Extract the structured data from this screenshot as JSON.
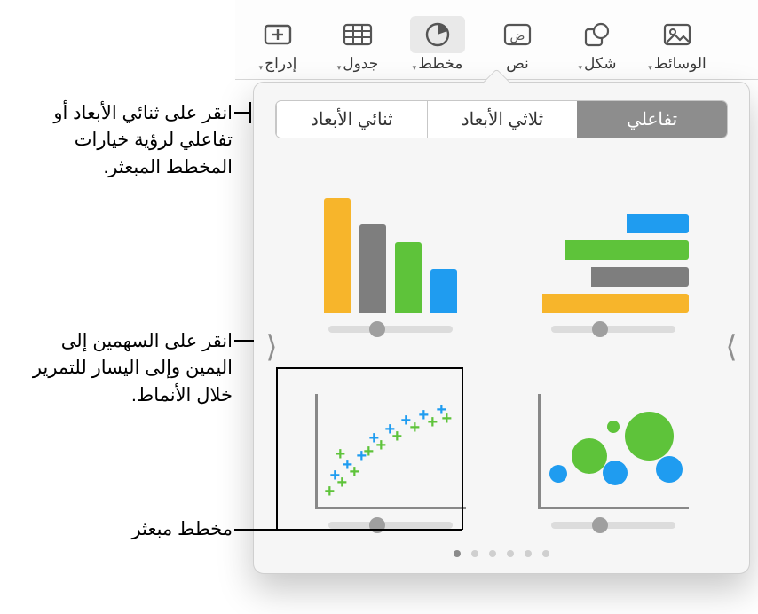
{
  "toolbar": {
    "insert": "إدراج",
    "table": "جدول",
    "chart": "مخطط",
    "text": "نص",
    "shape": "شكل",
    "media": "الوسائط"
  },
  "tabs": {
    "two_d": "ثنائي الأبعاد",
    "three_d": "ثلاثي الأبعاد",
    "interactive": "تفاعلي"
  },
  "callouts": {
    "tabs_hint": "انقر على ثنائي الأبعاد أو تفاعلي لرؤية خيارات المخطط المبعثر.",
    "arrows_hint": "انقر على السهمين إلى اليمين وإلى اليسار للتمرير خلال الأنماط.",
    "scatter_label": "مخطط مبعثر"
  },
  "colors": {
    "blue": "#1f9cf0",
    "green": "#5ec33a",
    "gray": "#7e7e7e",
    "yellow": "#f7b52b"
  }
}
